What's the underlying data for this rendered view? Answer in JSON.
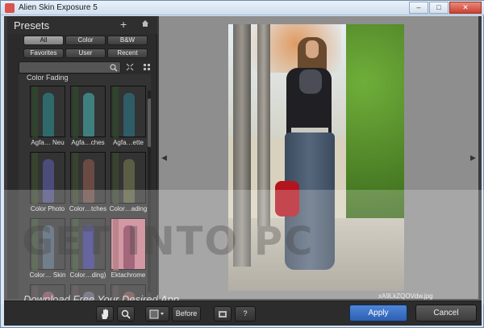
{
  "window": {
    "title": "Alien Skin Exposure 5",
    "minimize_glyph": "–",
    "maximize_glyph": "□",
    "close_glyph": "✕"
  },
  "presets_panel": {
    "title": "Presets",
    "add_glyph": "+",
    "filters": [
      "All",
      "Color",
      "B&W",
      "Favorites",
      "User",
      "Recent"
    ],
    "active_filter": "All",
    "search_value": "",
    "group_label": "Color Fading",
    "thumbnails": [
      {
        "label": "Agfa… Neu",
        "tint": "#2f6a6a"
      },
      {
        "label": "Agfa…ches",
        "tint": "#3f7f80"
      },
      {
        "label": "Agfa…ette",
        "tint": "#2e5c67"
      },
      {
        "label": "Color Photo",
        "tint": "#4b4c7a"
      },
      {
        "label": "Color…tches",
        "tint": "#6a4b43"
      },
      {
        "label": "Color…ading",
        "tint": "#5b5e45"
      },
      {
        "label": "Color… Skin",
        "tint": "#4a5a6b"
      },
      {
        "label": "Color…ding)",
        "tint": "#3c3a84"
      },
      {
        "label": "Ektachrome",
        "tint": "#8b3b56"
      },
      {
        "label": "",
        "tint": "#7a4a5e"
      },
      {
        "label": "",
        "tint": "#5a5a6e"
      },
      {
        "label": "",
        "tint": "#6d4a4a"
      }
    ]
  },
  "viewer": {
    "filename": "xA9LkZQOVdw.jpg"
  },
  "watermark": {
    "big": "GET INTO PC",
    "small": "Download Free Your Desired App"
  },
  "toolbar": {
    "before_label": "Before",
    "apply_label": "Apply",
    "cancel_label": "Cancel",
    "help_glyph": "?"
  },
  "colors": {
    "panel_bg": "#2b2b2b",
    "viewer_bg": "#8e8e8e",
    "apply_blue": "#3a6fc4"
  }
}
